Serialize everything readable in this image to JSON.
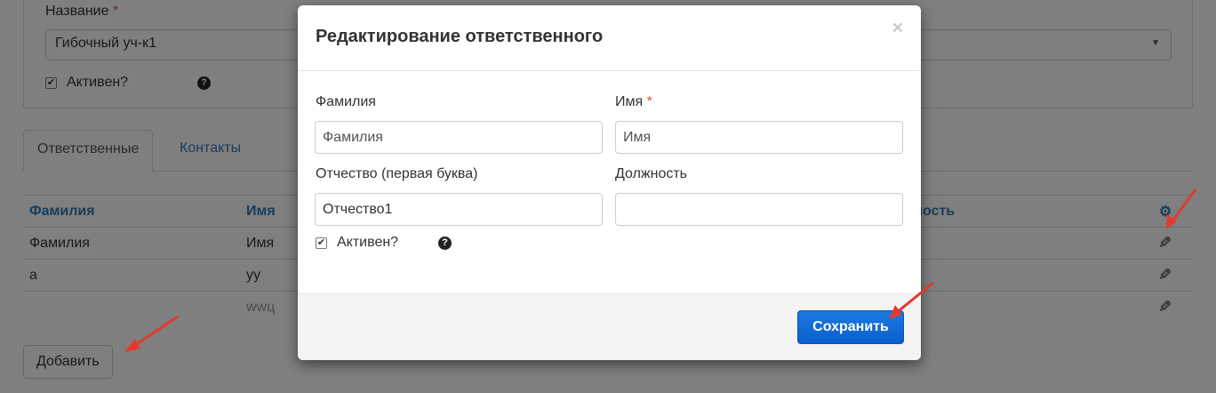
{
  "background": {
    "name_label": "Название",
    "required_mark": "*",
    "name_value": "Гибочный уч-к1",
    "active_label": "Активен?",
    "help_glyph": "?",
    "tabs": [
      {
        "label": "Ответственные"
      },
      {
        "label": "Контакты"
      }
    ],
    "table": {
      "headers": [
        "Фамилия",
        "Имя",
        "",
        "жность"
      ],
      "rows": [
        [
          "Фамилия",
          "Имя",
          "",
          ""
        ],
        [
          "а",
          "уу",
          "",
          ""
        ],
        [
          "",
          "wwц",
          "",
          ""
        ]
      ]
    },
    "add_button": "Добавить"
  },
  "modal": {
    "title": "Редактирование ответственного",
    "close_glyph": "×",
    "fields": {
      "surname": {
        "label": "Фамилия",
        "placeholder": "Фамилия",
        "value": ""
      },
      "name": {
        "label": "Имя",
        "required_mark": "*",
        "placeholder": "Имя",
        "value": ""
      },
      "patronymic": {
        "label": "Отчество (первая буква)",
        "value": "Отчество1"
      },
      "position": {
        "label": "Должность",
        "value": ""
      }
    },
    "active_label": "Активен?",
    "active_checked": true,
    "help_glyph": "?",
    "save_button": "Сохранить"
  },
  "colors": {
    "link": "#337ab7",
    "primary": "#0b5fcd",
    "annotation_arrow": "#e03a2e",
    "required": "#d9534f"
  }
}
